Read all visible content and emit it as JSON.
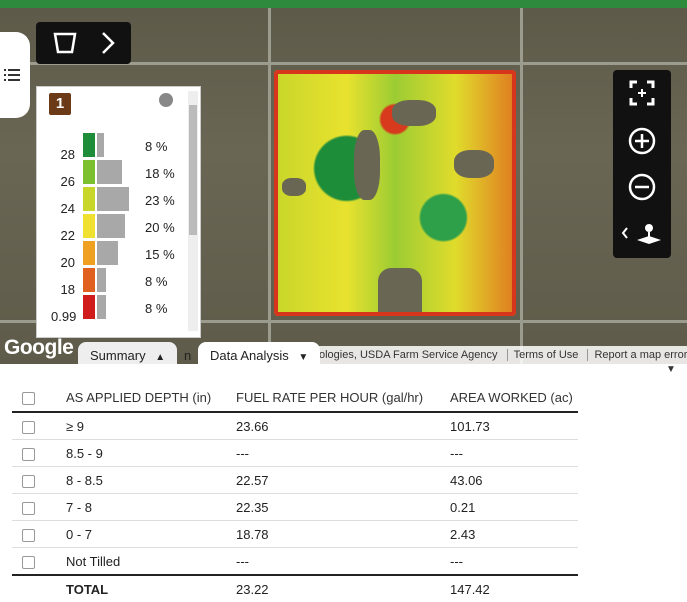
{
  "legend": {
    "layer_badge": "1",
    "rows": [
      {
        "label": "28",
        "pct": "8 %",
        "color": "#1e8d3a",
        "bar": 0.15
      },
      {
        "label": "26",
        "pct": "18 %",
        "color": "#7cc030",
        "bar": 0.55
      },
      {
        "label": "24",
        "pct": "23 %",
        "color": "#c8d62a",
        "bar": 0.7
      },
      {
        "label": "22",
        "pct": "20 %",
        "color": "#f0e030",
        "bar": 0.6
      },
      {
        "label": "20",
        "pct": "15 %",
        "color": "#f0a020",
        "bar": 0.45
      },
      {
        "label": "18",
        "pct": "8 %",
        "color": "#e06020",
        "bar": 0.2
      },
      {
        "label": "0.99",
        "pct": "8 %",
        "color": "#d01c1c",
        "bar": 0.2
      }
    ]
  },
  "map": {
    "google_logo": "Google",
    "attribution": "ologies, USDA Farm Service Agency",
    "terms": "Terms of Use",
    "report": "Report a map error"
  },
  "tabs": {
    "summary": "Summary",
    "data_analysis": "Data Analysis",
    "partial": "n"
  },
  "table": {
    "headers": [
      "AS APPLIED DEPTH (in)",
      "FUEL RATE PER HOUR (gal/hr)",
      "AREA WORKED (ac)"
    ],
    "rows": [
      [
        "≥ 9",
        "23.66",
        "101.73"
      ],
      [
        "8.5 - 9",
        "---",
        "---"
      ],
      [
        "8 - 8.5",
        "22.57",
        "43.06"
      ],
      [
        "7 - 8",
        "22.35",
        "0.21"
      ],
      [
        "0 - 7",
        "18.78",
        "2.43"
      ],
      [
        "Not Tilled",
        "---",
        "---"
      ]
    ],
    "total": [
      "TOTAL",
      "23.22",
      "147.42"
    ]
  }
}
